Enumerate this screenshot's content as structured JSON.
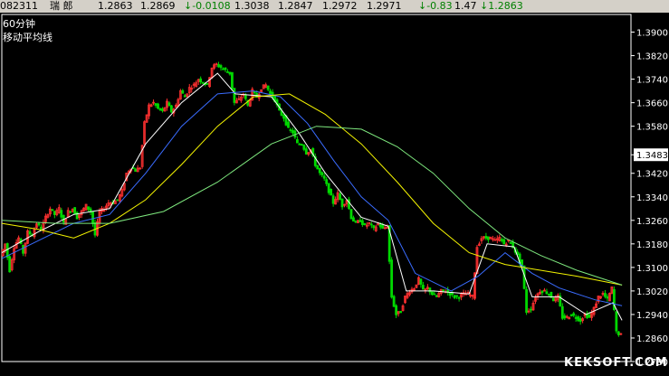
{
  "quote_bar": {
    "code": "082311",
    "name": "瑞 郎",
    "open": "1.2863",
    "high": "1.2869",
    "change": "↓-0.0108",
    "field4": "1.3038",
    "field5": "1.2847",
    "field6": "1.2972",
    "field7": "1.2971",
    "change_pct": "↓-0.83",
    "amplitude": "1.47",
    "last": "↓1.2863"
  },
  "period_label": "60分钟",
  "indicator_label": "移动平均线",
  "watermark": "KEKSOFT.COM",
  "colors": {
    "background": "#000000",
    "frame": "#ffffff",
    "candle_up": "#ff3030",
    "candle_down": "#00d800",
    "ma_white": "#ffffff",
    "ma_yellow": "#f4f400",
    "ma_blue": "#3a6cff",
    "ma_green": "#7ee87e",
    "price_tag_bg": "#ffffff",
    "price_tag_text": "#000000"
  },
  "chart_data": {
    "type": "line",
    "title": "",
    "xlabel": "",
    "ylabel": "",
    "ylim": [
      1.278,
      1.396
    ],
    "y_ticks": [
      "1.3900",
      "1.3820",
      "1.3740",
      "1.3660",
      "1.3580",
      "1.3483",
      "1.3420",
      "1.3340",
      "1.3260",
      "1.3180",
      "1.3100",
      "1.3020",
      "1.2940",
      "1.2860",
      "1.2780"
    ],
    "highlighted_price": "1.3483",
    "grid": false,
    "price_path": [
      [
        0,
        1.314
      ],
      [
        5,
        1.318
      ],
      [
        10,
        1.309
      ],
      [
        15,
        1.317
      ],
      [
        20,
        1.32
      ],
      [
        25,
        1.315
      ],
      [
        30,
        1.322
      ],
      [
        35,
        1.321
      ],
      [
        40,
        1.325
      ],
      [
        45,
        1.323
      ],
      [
        50,
        1.327
      ],
      [
        55,
        1.33
      ],
      [
        60,
        1.328
      ],
      [
        65,
        1.33
      ],
      [
        70,
        1.325
      ],
      [
        75,
        1.329
      ],
      [
        80,
        1.33
      ],
      [
        85,
        1.327
      ],
      [
        90,
        1.329
      ],
      [
        95,
        1.331
      ],
      [
        100,
        1.329
      ],
      [
        105,
        1.321
      ],
      [
        110,
        1.329
      ],
      [
        115,
        1.33
      ],
      [
        120,
        1.332
      ],
      [
        125,
        1.332
      ],
      [
        130,
        1.333
      ],
      [
        135,
        1.336
      ],
      [
        140,
        1.342
      ],
      [
        145,
        1.344
      ],
      [
        150,
        1.343
      ],
      [
        155,
        1.344
      ],
      [
        160,
        1.359
      ],
      [
        165,
        1.365
      ],
      [
        170,
        1.366
      ],
      [
        175,
        1.364
      ],
      [
        180,
        1.363
      ],
      [
        185,
        1.366
      ],
      [
        190,
        1.363
      ],
      [
        195,
        1.365
      ],
      [
        200,
        1.37
      ],
      [
        205,
        1.368
      ],
      [
        210,
        1.371
      ],
      [
        215,
        1.372
      ],
      [
        220,
        1.374
      ],
      [
        225,
        1.373
      ],
      [
        230,
        1.372
      ],
      [
        235,
        1.378
      ],
      [
        240,
        1.379
      ],
      [
        245,
        1.378
      ],
      [
        250,
        1.377
      ],
      [
        255,
        1.376
      ],
      [
        260,
        1.366
      ],
      [
        265,
        1.367
      ],
      [
        270,
        1.369
      ],
      [
        275,
        1.365
      ],
      [
        280,
        1.37
      ],
      [
        285,
        1.368
      ],
      [
        290,
        1.371
      ],
      [
        295,
        1.372
      ],
      [
        300,
        1.369
      ],
      [
        305,
        1.367
      ],
      [
        310,
        1.363
      ],
      [
        315,
        1.361
      ],
      [
        320,
        1.357
      ],
      [
        325,
        1.356
      ],
      [
        330,
        1.352
      ],
      [
        335,
        1.352
      ],
      [
        340,
        1.349
      ],
      [
        345,
        1.35
      ],
      [
        350,
        1.345
      ],
      [
        355,
        1.342
      ],
      [
        360,
        1.34
      ],
      [
        365,
        1.336
      ],
      [
        370,
        1.332
      ],
      [
        375,
        1.335
      ],
      [
        380,
        1.331
      ],
      [
        385,
        1.333
      ],
      [
        390,
        1.327
      ],
      [
        395,
        1.325
      ],
      [
        400,
        1.326
      ],
      [
        405,
        1.324
      ],
      [
        410,
        1.325
      ],
      [
        415,
        1.323
      ],
      [
        420,
        1.325
      ],
      [
        425,
        1.323
      ],
      [
        430,
        1.324
      ],
      [
        435,
        1.3
      ],
      [
        440,
        1.294
      ],
      [
        445,
        1.295
      ],
      [
        450,
        1.3
      ],
      [
        455,
        1.302
      ],
      [
        460,
        1.303
      ],
      [
        465,
        1.306
      ],
      [
        470,
        1.302
      ],
      [
        475,
        1.303
      ],
      [
        480,
        1.301
      ],
      [
        485,
        1.3
      ],
      [
        490,
        1.302
      ],
      [
        495,
        1.302
      ],
      [
        500,
        1.301
      ],
      [
        505,
        1.3
      ],
      [
        510,
        1.3
      ],
      [
        515,
        1.301
      ],
      [
        520,
        1.301
      ],
      [
        525,
        1.3
      ],
      [
        530,
        1.317
      ],
      [
        535,
        1.32
      ],
      [
        540,
        1.32
      ],
      [
        545,
        1.32
      ],
      [
        550,
        1.319
      ],
      [
        555,
        1.32
      ],
      [
        560,
        1.318
      ],
      [
        565,
        1.319
      ],
      [
        570,
        1.317
      ],
      [
        575,
        1.314
      ],
      [
        580,
        1.31
      ],
      [
        585,
        1.295
      ],
      [
        590,
        1.296
      ],
      [
        595,
        1.3
      ],
      [
        600,
        1.302
      ],
      [
        605,
        1.302
      ],
      [
        610,
        1.301
      ],
      [
        615,
        1.299
      ],
      [
        620,
        1.3
      ],
      [
        625,
        1.293
      ],
      [
        630,
        1.293
      ],
      [
        635,
        1.294
      ],
      [
        640,
        1.293
      ],
      [
        645,
        1.292
      ],
      [
        650,
        1.294
      ],
      [
        655,
        1.293
      ],
      [
        660,
        1.296
      ],
      [
        665,
        1.3
      ],
      [
        670,
        1.301
      ],
      [
        675,
        1.299
      ],
      [
        680,
        1.303
      ],
      [
        685,
        1.288
      ],
      [
        690,
        1.287
      ]
    ],
    "series": [
      {
        "color": "#ffffff",
        "values": [
          [
            0,
            1.315
          ],
          [
            40,
            1.322
          ],
          [
            80,
            1.328
          ],
          [
            120,
            1.33
          ],
          [
            160,
            1.352
          ],
          [
            200,
            1.366
          ],
          [
            240,
            1.376
          ],
          [
            260,
            1.369
          ],
          [
            300,
            1.368
          ],
          [
            330,
            1.356
          ],
          [
            360,
            1.342
          ],
          [
            400,
            1.327
          ],
          [
            430,
            1.324
          ],
          [
            450,
            1.302
          ],
          [
            480,
            1.302
          ],
          [
            520,
            1.301
          ],
          [
            540,
            1.318
          ],
          [
            570,
            1.317
          ],
          [
            590,
            1.3
          ],
          [
            620,
            1.3
          ],
          [
            650,
            1.294
          ],
          [
            680,
            1.298
          ],
          [
            690,
            1.292
          ]
        ]
      },
      {
        "color": "#3a6cff",
        "values": [
          [
            0,
            1.313
          ],
          [
            40,
            1.319
          ],
          [
            80,
            1.325
          ],
          [
            120,
            1.328
          ],
          [
            160,
            1.342
          ],
          [
            200,
            1.358
          ],
          [
            240,
            1.369
          ],
          [
            280,
            1.37
          ],
          [
            310,
            1.368
          ],
          [
            340,
            1.359
          ],
          [
            370,
            1.346
          ],
          [
            400,
            1.334
          ],
          [
            430,
            1.326
          ],
          [
            460,
            1.308
          ],
          [
            500,
            1.302
          ],
          [
            530,
            1.307
          ],
          [
            560,
            1.315
          ],
          [
            590,
            1.308
          ],
          [
            620,
            1.303
          ],
          [
            660,
            1.299
          ],
          [
            690,
            1.297
          ]
        ]
      },
      {
        "color": "#f4f400",
        "values": [
          [
            0,
            1.325
          ],
          [
            40,
            1.323
          ],
          [
            80,
            1.32
          ],
          [
            120,
            1.325
          ],
          [
            160,
            1.333
          ],
          [
            200,
            1.345
          ],
          [
            240,
            1.358
          ],
          [
            280,
            1.368
          ],
          [
            320,
            1.369
          ],
          [
            360,
            1.362
          ],
          [
            400,
            1.352
          ],
          [
            440,
            1.339
          ],
          [
            480,
            1.325
          ],
          [
            520,
            1.315
          ],
          [
            560,
            1.311
          ],
          [
            600,
            1.309
          ],
          [
            640,
            1.307
          ],
          [
            690,
            1.304
          ]
        ]
      },
      {
        "color": "#7ee87e",
        "values": [
          [
            0,
            1.326
          ],
          [
            60,
            1.325
          ],
          [
            120,
            1.325
          ],
          [
            180,
            1.329
          ],
          [
            240,
            1.339
          ],
          [
            300,
            1.352
          ],
          [
            350,
            1.358
          ],
          [
            400,
            1.357
          ],
          [
            440,
            1.351
          ],
          [
            480,
            1.342
          ],
          [
            520,
            1.33
          ],
          [
            560,
            1.32
          ],
          [
            600,
            1.314
          ],
          [
            640,
            1.309
          ],
          [
            690,
            1.304
          ]
        ]
      }
    ]
  }
}
